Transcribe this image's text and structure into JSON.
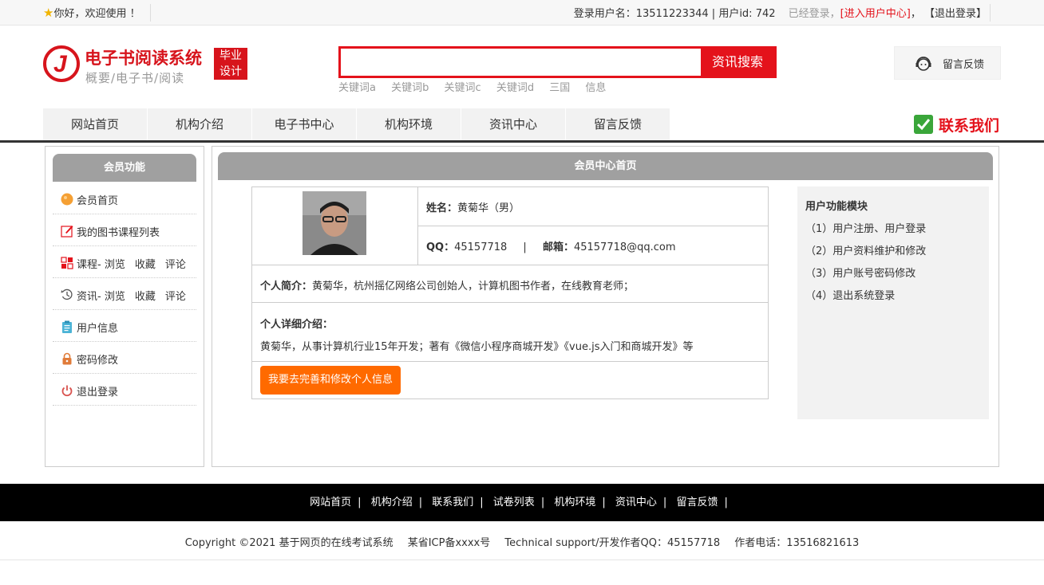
{
  "topbar": {
    "welcome": "你好，欢迎使用 ！",
    "login_user": "登录用户名：13511223344 | 用户id: 742",
    "status": "已经登录，",
    "enter_center": "[进入用户中心]",
    "comma": "，",
    "logout": "【退出登录】"
  },
  "header": {
    "logo_title": "电子书阅读系统",
    "logo_subtitle": "概要/电子书/阅读",
    "logo_badge_line1": "毕业",
    "logo_badge_line2": "设计",
    "search_button": "资讯搜索",
    "search_value": "",
    "keywords": [
      "关键词a",
      "关键词b",
      "关键词c",
      "关键词d",
      "三国",
      "信息"
    ],
    "feedback": "留言反馈",
    "contact": "联系我们"
  },
  "nav": [
    "网站首页",
    "机构介绍",
    "电子书中心",
    "机构环境",
    "资讯中心",
    "留言反馈"
  ],
  "sidebar": {
    "title": "会员功能",
    "items": [
      {
        "label": "会员首页",
        "icon": "circle-icon"
      },
      {
        "label": "我的图书课程列表",
        "icon": "edit-icon"
      },
      {
        "label": "课程- 浏览",
        "extra1": "收藏",
        "extra2": "评论",
        "icon": "grid-icon"
      },
      {
        "label": "资讯- 浏览",
        "extra1": "收藏",
        "extra2": "评论",
        "icon": "clock-icon"
      },
      {
        "label": "用户信息",
        "icon": "clipboard-icon"
      },
      {
        "label": "密码修改",
        "icon": "lock-icon"
      },
      {
        "label": "退出登录",
        "icon": "power-icon"
      }
    ]
  },
  "main": {
    "title": "会员中心首页",
    "name_label": "姓名：",
    "name_value": "黄菊华（男）",
    "qq_label": "QQ：",
    "qq_value": "45157718",
    "divider": "|",
    "email_label": "邮箱：",
    "email_value": "45157718@qq.com",
    "intro_label": "个人简介：",
    "intro_value": "黄菊华，杭州摇亿网络公司创始人，计算机图书作者，在线教育老师；",
    "detail_label": "个人详细介绍：",
    "detail_value": "黄菊华，从事计算机行业15年开发；著有《微信小程序商城开发》《vue.js入门和商城开发》等",
    "edit_button": "我要去完善和修改个人信息"
  },
  "modules": {
    "title": "用户功能模块",
    "items": [
      "（1）用户注册、用户登录",
      "（2）用户资料维护和修改",
      "（3）用户账号密码修改",
      "（4）退出系统登录"
    ]
  },
  "footer": {
    "links": [
      "网站首页",
      "机构介绍",
      "联系我们",
      "试卷列表",
      "机构环境",
      "资讯中心",
      "留言反馈"
    ],
    "separator": "|",
    "copyright": "Copyright ©2021 基于网页的在线考试系统",
    "icp": "某省ICP备xxxx号",
    "support": "Technical support/开发作者QQ：45157718",
    "phone": "作者电话：13516821613"
  },
  "colors": {
    "accent": "#e4121b",
    "button_orange": "#ff6a00",
    "panel_header": "#a0a0a0"
  }
}
